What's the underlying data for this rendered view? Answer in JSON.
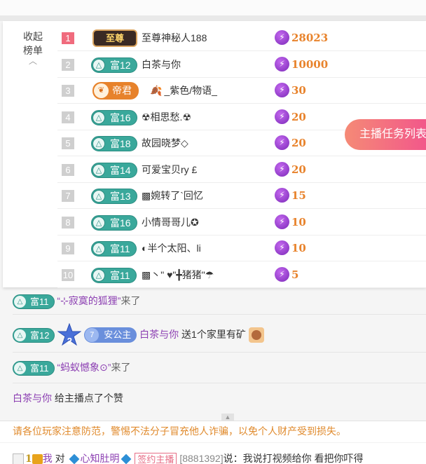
{
  "collapse": {
    "label": "收起\n榜单"
  },
  "rank_list": [
    {
      "rank": "1",
      "badge": {
        "type": "zhizun",
        "label": "至尊"
      },
      "name": "至尊神秘人188",
      "amount": "28023"
    },
    {
      "rank": "2",
      "badge": {
        "type": "fu",
        "label": "富12"
      },
      "name": "白茶与你",
      "amount": "10000"
    },
    {
      "rank": "3",
      "badge": {
        "type": "dijun",
        "label": "帝君"
      },
      "name": "_紫色/物语_",
      "amount": "30"
    },
    {
      "rank": "4",
      "badge": {
        "type": "fu",
        "label": "富16"
      },
      "name": "☢相思愁.☢",
      "amount": "20"
    },
    {
      "rank": "5",
      "badge": {
        "type": "fu",
        "label": "富18"
      },
      "name": "故园晓梦◇",
      "amount": "20"
    },
    {
      "rank": "6",
      "badge": {
        "type": "fu",
        "label": "富14"
      },
      "name": "可爱宝贝ry £",
      "amount": "20"
    },
    {
      "rank": "7",
      "badge": {
        "type": "fu",
        "label": "富13"
      },
      "name": "▩婉转了`回忆",
      "amount": "15"
    },
    {
      "rank": "8",
      "badge": {
        "type": "fu",
        "label": "富16"
      },
      "name": "小情哥哥儿✪",
      "amount": "10"
    },
    {
      "rank": "9",
      "badge": {
        "type": "fu",
        "label": "富11"
      },
      "name": "◐半个太阳、li",
      "amount": "10"
    },
    {
      "rank": "10",
      "badge": {
        "type": "fu",
        "label": "富11"
      },
      "name": "▩丶\" ♥\"╋猪猪\"☂",
      "amount": "5"
    }
  ],
  "task_button": {
    "label": "主播任务列表"
  },
  "chat": {
    "m1": {
      "badge": "富11",
      "name": "“⊹寂寞的狐狸”",
      "text": "来了"
    },
    "m2": {
      "badge": "富12",
      "medal": "2",
      "guard_level": "7",
      "guard_label": "安公主",
      "user": "白茶与你",
      "text": "送1个家里有矿"
    },
    "m3": {
      "badge": "富11",
      "name": "“蚂蚁憾象⊙”",
      "text": "来了"
    },
    "m4": {
      "user": "白茶与你",
      "text": "给主播点了个赞"
    }
  },
  "notice": "请各位玩家注意防范，警惕不法分子冒充他人诈骗，以免个人财产受到损失。",
  "bottom": {
    "level": "1",
    "me": "我",
    "to": "对",
    "target": "心知肚明",
    "tag": "签约主播",
    "id": "[8881392]",
    "said": "说：",
    "message": "我说打视频给你 看把你吓得"
  },
  "colors": {
    "accent": "#8c3fb2",
    "fu_badge": "#3aa89b",
    "amount": "#e8832c",
    "notice": "#e08a2c",
    "task_gradient_start": "#f58a76",
    "task_gradient_end": "#f2568b"
  }
}
